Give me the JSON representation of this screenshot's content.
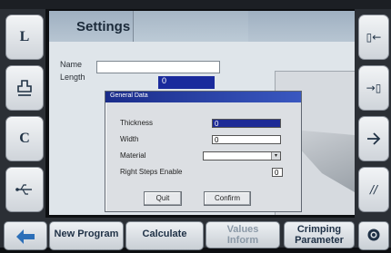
{
  "header": {
    "title": "Settings"
  },
  "left_buttons": [
    {
      "label": "L"
    },
    {
      "icon": "tool-icon"
    },
    {
      "label": "C"
    },
    {
      "icon": "usb-icon"
    }
  ],
  "right_buttons": [
    {
      "icon": "page-back-icon"
    },
    {
      "icon": "page-forward-icon"
    },
    {
      "icon": "arrow-right-icon"
    },
    {
      "icon": "slash-icon"
    }
  ],
  "form": {
    "name_label": "Name",
    "length_label": "Length",
    "length_value": "0"
  },
  "dialog": {
    "title": "General Data",
    "fields": [
      {
        "label": "Thickness",
        "value": "0"
      },
      {
        "label": "Width",
        "value": "0"
      },
      {
        "label": "Material",
        "value": ""
      },
      {
        "label": "Right Steps Enable",
        "value": "0"
      }
    ],
    "quit_label": "Quit",
    "confirm_label": "Confirm"
  },
  "bottom_bar": {
    "new_program": "New Program",
    "calculate": "Calculate",
    "values_line1": "Values",
    "values_line2": "Inform",
    "crimping_line1": "Crimping",
    "crimping_line2": "Parameter"
  }
}
